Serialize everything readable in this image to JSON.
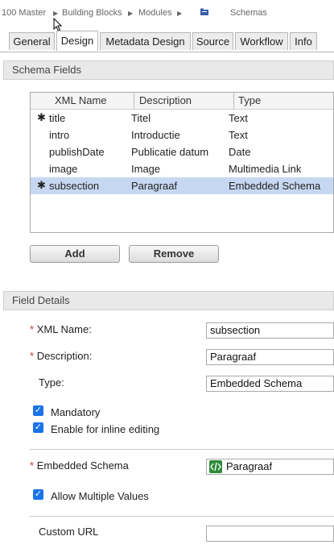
{
  "breadcrumb": {
    "items": [
      "100 Master",
      "Building Blocks",
      "Modules",
      "Schemas"
    ]
  },
  "tabs": [
    {
      "label": "General",
      "active": false
    },
    {
      "label": "Design",
      "active": true
    },
    {
      "label": "Metadata Design",
      "active": false
    },
    {
      "label": "Source",
      "active": false
    },
    {
      "label": "Workflow",
      "active": false
    },
    {
      "label": "Info",
      "active": false
    }
  ],
  "schema_fields": {
    "title": "Schema Fields",
    "columns": [
      "XML Name",
      "Description",
      "Type"
    ],
    "rows": [
      {
        "mandatory": true,
        "xml_name": "title",
        "description": "Titel",
        "type": "Text",
        "selected": false
      },
      {
        "mandatory": false,
        "xml_name": "intro",
        "description": "Introductie",
        "type": "Text",
        "selected": false
      },
      {
        "mandatory": false,
        "xml_name": "publishDate",
        "description": "Publicatie datum",
        "type": "Date",
        "selected": false
      },
      {
        "mandatory": false,
        "xml_name": "image",
        "description": "Image",
        "type": "Multimedia Link",
        "selected": false
      },
      {
        "mandatory": true,
        "xml_name": "subsection",
        "description": "Paragraaf",
        "type": "Embedded Schema",
        "selected": true
      }
    ],
    "add_label": "Add",
    "remove_label": "Remove"
  },
  "field_details": {
    "title": "Field Details",
    "xml_name_label": "XML Name:",
    "xml_name_value": "subsection",
    "description_label": "Description:",
    "description_value": "Paragraaf",
    "type_label": "Type:",
    "type_value": "Embedded Schema",
    "mandatory_label": "Mandatory",
    "mandatory_checked": true,
    "inline_label": "Enable for inline editing",
    "inline_checked": true,
    "embedded_schema_label": "Embedded Schema",
    "embedded_schema_value": "Paragraaf",
    "allow_multiple_label": "Allow Multiple Values",
    "allow_multiple_checked": true,
    "custom_url_label": "Custom URL",
    "custom_url_value": ""
  },
  "colors": {
    "selected_row": "#c6d8f1",
    "required_star": "#c0392b",
    "checkbox": "#1a73e8",
    "schema_icon": "#2e8b3a"
  }
}
